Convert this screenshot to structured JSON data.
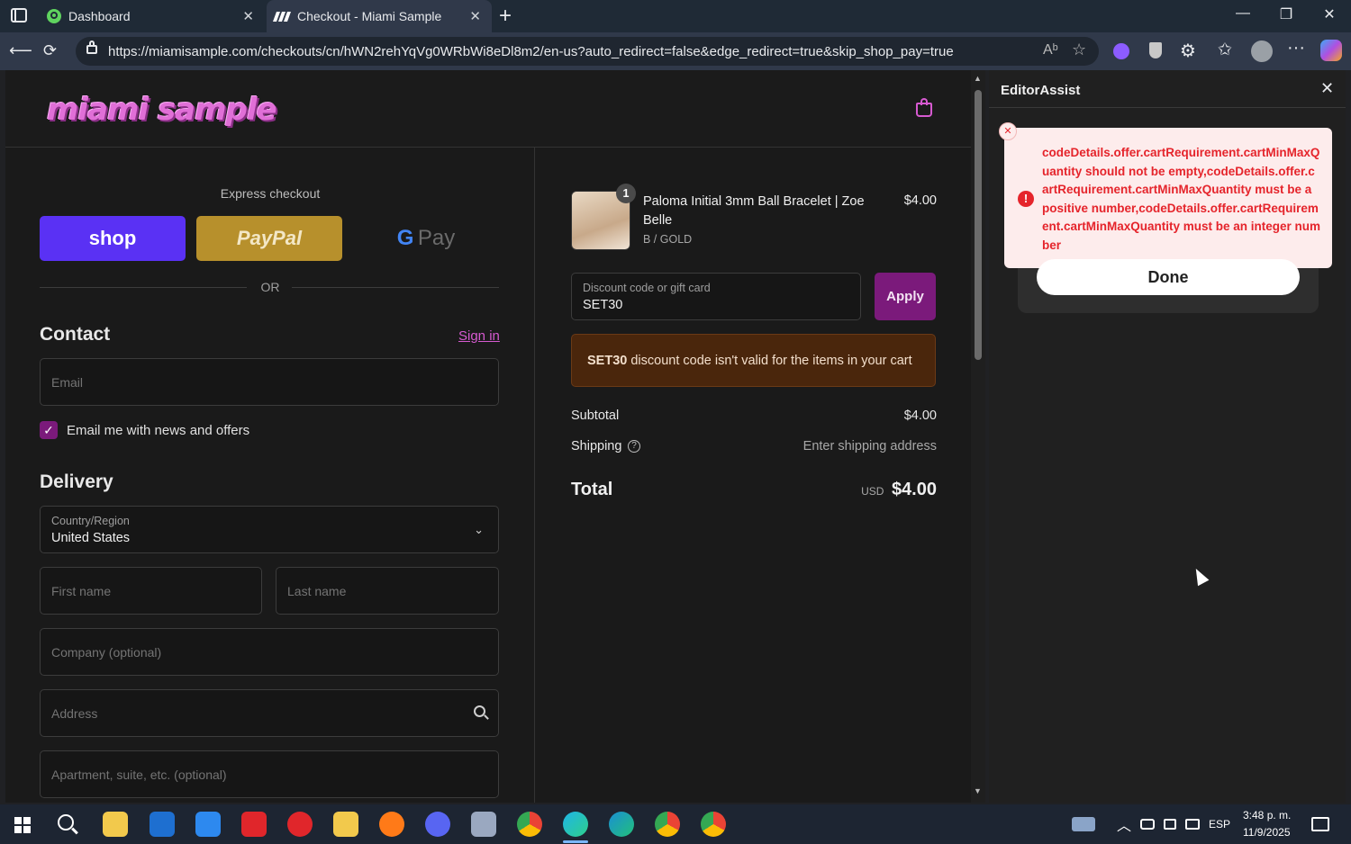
{
  "browser": {
    "tabs": [
      {
        "title": "Dashboard"
      },
      {
        "title": "Checkout - Miami Sample"
      }
    ],
    "url": "https://miamisample.com/checkouts/cn/hWN2rehYqVg0WRbWi8eDl8m2/en-us?auto_redirect=false&edge_redirect=true&skip_shop_pay=true"
  },
  "checkout": {
    "logo_text": "miami sample",
    "express_checkout_label": "Express checkout",
    "shop_label": "shop",
    "paypal_label": "PayPal",
    "gpay_label": "Pay",
    "or_label": "OR",
    "contact_heading": "Contact",
    "sign_in_label": "Sign in",
    "email_placeholder": "Email",
    "email_news_label": "Email me with news and offers",
    "delivery_heading": "Delivery",
    "country_label": "Country/Region",
    "country_value": "United States",
    "first_name_placeholder": "First name",
    "last_name_placeholder": "Last name",
    "company_placeholder": "Company (optional)",
    "address_placeholder": "Address",
    "apartment_placeholder": "Apartment, suite, etc. (optional)"
  },
  "summary": {
    "item_qty": "1",
    "item_name": "Paloma Initial 3mm Ball Bracelet | Zoe Belle",
    "item_variant": "B / GOLD",
    "item_price": "$4.00",
    "discount_label": "Discount code or gift card",
    "discount_value": "SET30",
    "apply_label": "Apply",
    "discount_error_code": "SET30",
    "discount_error_text": " discount code isn't valid for the items in your cart",
    "subtotal_label": "Subtotal",
    "subtotal_value": "$4.00",
    "shipping_label": "Shipping",
    "shipping_value": "Enter shipping address",
    "total_label": "Total",
    "total_currency": "USD",
    "total_value": "$4.00"
  },
  "panel": {
    "title": "EditorAssist",
    "error_message": "codeDetails.offer.cartRequirement.cartMinMaxQuantity should not be empty,codeDetails.offer.cartRequirement.cartMinMaxQuantity must be a positive number,codeDetails.offer.cartRequirement.cartMinMaxQuantity must be an integer number",
    "done_label": "Done"
  },
  "taskbar": {
    "language": "ESP",
    "time": "3:48 p. m.",
    "date": "11/9/2025"
  },
  "colors": {
    "accent": "#7b1a7b",
    "error": "#e5242b",
    "shop": "#5a31f4",
    "paypal": "#b7902c"
  }
}
